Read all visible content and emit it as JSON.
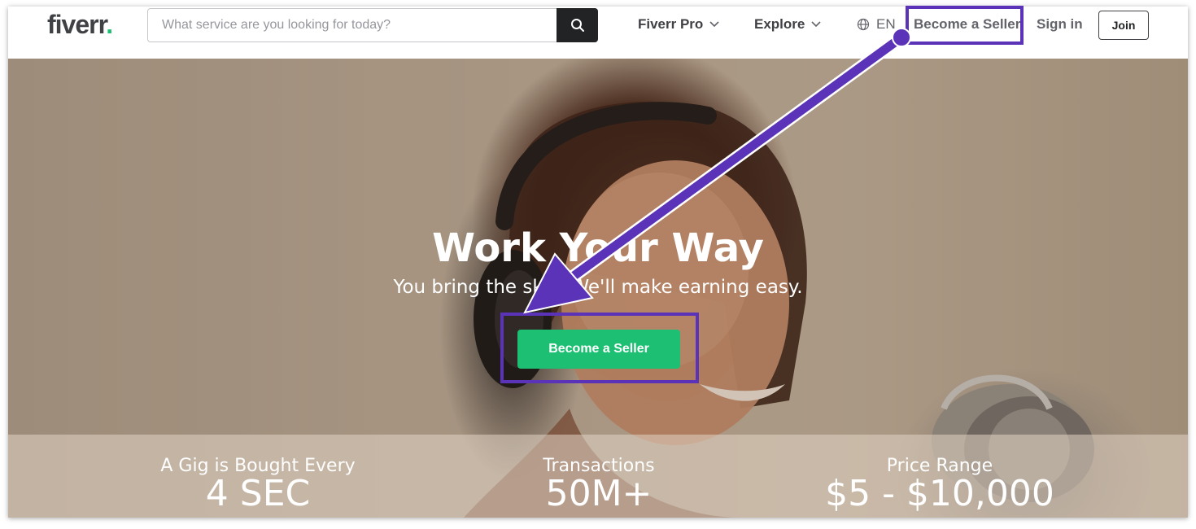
{
  "header": {
    "logo": "fiverr",
    "logo_dot": ".",
    "search_placeholder": "What service are you looking for today?",
    "nav": {
      "fiverr_pro": "Fiverr Pro",
      "explore": "Explore",
      "language": "EN",
      "become_seller": "Become a Seller",
      "sign_in": "Sign in",
      "join": "Join"
    }
  },
  "hero": {
    "title": "Work Your Way",
    "subtitle": "You bring the skill. We'll make earning easy.",
    "cta": "Become a Seller"
  },
  "stats": [
    {
      "label": "A Gig is Bought Every",
      "value": "4 SEC"
    },
    {
      "label": "Transactions",
      "value": "50M+"
    },
    {
      "label": "Price Range",
      "value": "$5 - $10,000"
    }
  ],
  "colors": {
    "brand_green": "#1dbf73",
    "annotation_purple": "#5b33b8",
    "dark": "#222325"
  },
  "icons": {
    "search": "search-icon",
    "chevron": "chevron-down-icon",
    "globe": "globe-icon"
  }
}
